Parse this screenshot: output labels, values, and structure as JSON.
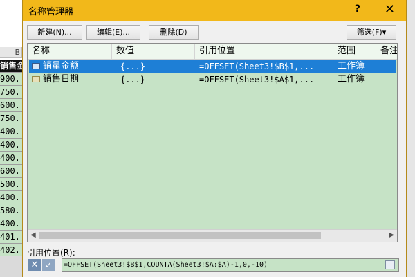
{
  "sheet": {
    "column_header": "B",
    "header_cell": "销售金",
    "cells": [
      "900.",
      "750.",
      "600.",
      "750.",
      "400.",
      "400.",
      "400.",
      "600.",
      "500.",
      "400.",
      "580.",
      "400.",
      "401.",
      "402."
    ]
  },
  "dialog": {
    "title": "名称管理器",
    "help": "?",
    "close": "✕",
    "buttons": {
      "new": "新建(N)...",
      "edit": "编辑(E)...",
      "delete": "删除(D)",
      "filter": "筛选(F)▾"
    },
    "columns": [
      "名称",
      "数值",
      "引用位置",
      "范围",
      "备注"
    ],
    "rows": [
      {
        "name": "销量金额",
        "value": "{...}",
        "refers_to": "=OFFSET(Sheet3!$B$1,...",
        "scope": "工作簿",
        "selected": true
      },
      {
        "name": "销售日期",
        "value": "{...}",
        "refers_to": "=OFFSET(Sheet3!$A$1,...",
        "scope": "工作簿",
        "selected": false
      }
    ],
    "ref_label": "引用位置(R):",
    "ref_cancel": "✕",
    "ref_ok": "✓",
    "ref_value": "=OFFSET(Sheet3!$B$1,COUNTA(Sheet3!$A:$A)-1,0,-10)"
  },
  "colors": {
    "titlebar": "#f2b81a",
    "list_bg": "#c6e3c6",
    "selection": "#1e7fd6"
  }
}
